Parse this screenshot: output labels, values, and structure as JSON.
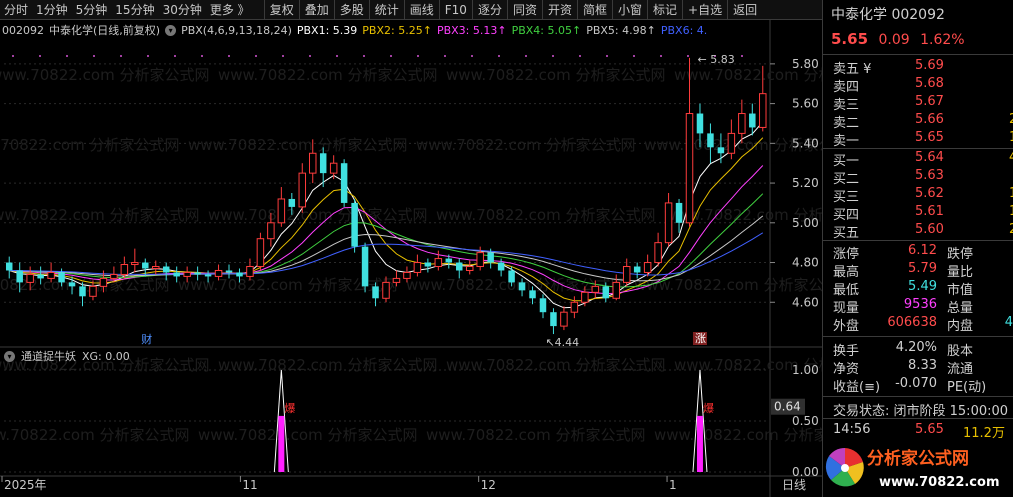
{
  "toolbar": {
    "periods": [
      "分时",
      "1分钟",
      "5分钟",
      "15分钟",
      "30分钟",
      "更多 》"
    ],
    "tools": [
      "复权",
      "叠加",
      "多股",
      "统计",
      "画线",
      "F10",
      "逐分",
      "同资",
      "开资",
      "简框",
      "小窗",
      "标记",
      "+自选",
      "返回"
    ]
  },
  "chart": {
    "code": "002092",
    "name": "中泰化学(日线,前复权)",
    "indicator": "PBX(4,6,9,13,18,24)",
    "pbx": [
      {
        "label": "PBX1: 5.39",
        "color": "#ffffff"
      },
      {
        "label": "PBX2: 5.25↑",
        "color": "#e8c000"
      },
      {
        "label": "PBX3: 5.13↑",
        "color": "#ff40ff"
      },
      {
        "label": "PBX4: 5.05↑",
        "color": "#40d040"
      },
      {
        "label": "PBX5: 4.98↑",
        "color": "#c8c8c8"
      },
      {
        "label": "PBX6: 4.",
        "color": "#4060ff"
      }
    ],
    "max_label": "5.83",
    "min_label": "4.44",
    "price_axis": [
      "5.80",
      "5.60",
      "5.40",
      "5.20",
      "5.00",
      "4.80",
      "4.60"
    ],
    "marker_cai": "财",
    "marker_zhang": "涨",
    "watermark": "www.70822.com 分析家公式网"
  },
  "indicator_panel": {
    "name": "通道捉牛妖",
    "xg": "XG: 0.00",
    "axis": [
      "1.00",
      "0.50",
      "0.00"
    ],
    "cursor_value": "0.64",
    "signal_label": "爆"
  },
  "date_axis": {
    "labels": [
      "2025年",
      "11",
      "12",
      "1"
    ],
    "right": "日线"
  },
  "chart_data": {
    "type": "candlestick",
    "title": "002092 中泰化学(日线,前复权)",
    "ylim": [
      4.4,
      5.9
    ],
    "candles": [
      [
        4.8,
        4.76,
        4.83,
        4.72
      ],
      [
        4.76,
        4.7,
        4.8,
        4.65
      ],
      [
        4.7,
        4.74,
        4.78,
        4.66
      ],
      [
        4.74,
        4.72,
        4.78,
        4.69
      ],
      [
        4.72,
        4.75,
        4.8,
        4.7
      ],
      [
        4.75,
        4.7,
        4.77,
        4.68
      ],
      [
        4.7,
        4.68,
        4.73,
        4.64
      ],
      [
        4.68,
        4.63,
        4.7,
        4.58
      ],
      [
        4.63,
        4.68,
        4.71,
        4.61
      ],
      [
        4.68,
        4.72,
        4.76,
        4.65
      ],
      [
        4.72,
        4.74,
        4.78,
        4.7
      ],
      [
        4.74,
        4.79,
        4.83,
        4.72
      ],
      [
        4.79,
        4.8,
        4.87,
        4.75
      ],
      [
        4.8,
        4.77,
        4.82,
        4.73
      ],
      [
        4.77,
        4.78,
        4.81,
        4.74
      ],
      [
        4.78,
        4.75,
        4.8,
        4.71
      ],
      [
        4.75,
        4.73,
        4.78,
        4.7
      ],
      [
        4.73,
        4.75,
        4.78,
        4.7
      ],
      [
        4.75,
        4.74,
        4.78,
        4.71
      ],
      [
        4.74,
        4.73,
        4.76,
        4.7
      ],
      [
        4.73,
        4.76,
        4.79,
        4.71
      ],
      [
        4.76,
        4.75,
        4.79,
        4.72
      ],
      [
        4.75,
        4.73,
        4.77,
        4.7
      ],
      [
        4.73,
        4.78,
        4.82,
        4.71
      ],
      [
        4.78,
        4.92,
        4.95,
        4.76
      ],
      [
        4.92,
        5.0,
        5.05,
        4.88
      ],
      [
        5.0,
        5.12,
        5.18,
        4.98
      ],
      [
        5.12,
        5.08,
        5.15,
        5.04
      ],
      [
        5.08,
        5.25,
        5.3,
        5.05
      ],
      [
        5.25,
        5.35,
        5.42,
        5.2
      ],
      [
        5.35,
        5.25,
        5.38,
        5.18
      ],
      [
        5.25,
        5.3,
        5.34,
        5.22
      ],
      [
        5.3,
        5.1,
        5.32,
        5.08
      ],
      [
        5.1,
        4.88,
        5.12,
        4.85
      ],
      [
        4.88,
        4.68,
        4.9,
        4.65
      ],
      [
        4.68,
        4.62,
        4.7,
        4.58
      ],
      [
        4.62,
        4.7,
        4.73,
        4.6
      ],
      [
        4.7,
        4.72,
        4.76,
        4.68
      ],
      [
        4.72,
        4.75,
        4.78,
        4.7
      ],
      [
        4.75,
        4.8,
        4.84,
        4.73
      ],
      [
        4.8,
        4.78,
        4.82,
        4.75
      ],
      [
        4.78,
        4.82,
        4.86,
        4.76
      ],
      [
        4.82,
        4.8,
        4.84,
        4.77
      ],
      [
        4.8,
        4.76,
        4.82,
        4.72
      ],
      [
        4.76,
        4.78,
        4.81,
        4.74
      ],
      [
        4.78,
        4.85,
        4.88,
        4.76
      ],
      [
        4.85,
        4.8,
        4.87,
        4.77
      ],
      [
        4.8,
        4.76,
        4.82,
        4.73
      ],
      [
        4.76,
        4.7,
        4.78,
        4.68
      ],
      [
        4.7,
        4.66,
        4.72,
        4.63
      ],
      [
        4.66,
        4.62,
        4.68,
        4.59
      ],
      [
        4.62,
        4.55,
        4.64,
        4.52
      ],
      [
        4.55,
        4.48,
        4.57,
        4.44
      ],
      [
        4.48,
        4.55,
        4.58,
        4.46
      ],
      [
        4.55,
        4.6,
        4.63,
        4.52
      ],
      [
        4.6,
        4.65,
        4.68,
        4.58
      ],
      [
        4.65,
        4.68,
        4.71,
        4.62
      ],
      [
        4.68,
        4.62,
        4.7,
        4.6
      ],
      [
        4.62,
        4.7,
        4.74,
        4.61
      ],
      [
        4.7,
        4.78,
        4.82,
        4.68
      ],
      [
        4.78,
        4.75,
        4.8,
        4.72
      ],
      [
        4.75,
        4.8,
        4.84,
        4.73
      ],
      [
        4.8,
        4.9,
        4.95,
        4.78
      ],
      [
        4.9,
        5.1,
        5.15,
        4.88
      ],
      [
        5.1,
        5.0,
        5.12,
        4.95
      ],
      [
        5.0,
        5.55,
        5.83,
        4.98
      ],
      [
        5.55,
        5.45,
        5.6,
        5.38
      ],
      [
        5.45,
        5.38,
        5.5,
        5.3
      ],
      [
        5.38,
        5.35,
        5.45,
        5.3
      ],
      [
        5.35,
        5.45,
        5.52,
        5.32
      ],
      [
        5.45,
        5.55,
        5.62,
        5.4
      ],
      [
        5.55,
        5.48,
        5.6,
        5.44
      ],
      [
        5.48,
        5.65,
        5.79,
        5.46
      ]
    ],
    "indicator": {
      "name": "通道捉牛妖",
      "signals_at_index": [
        26,
        66
      ],
      "ylim": [
        0,
        1
      ]
    }
  },
  "panel": {
    "title": "中泰化学 002092",
    "price": "5.65",
    "change": "0.09",
    "pct": "1.62%",
    "asks": [
      {
        "l": "卖五 ¥",
        "p": "5.69"
      },
      {
        "l": "卖四",
        "p": "5.68"
      },
      {
        "l": "卖三",
        "p": "5.67"
      },
      {
        "l": "卖二",
        "p": "5.66",
        "v": "2"
      },
      {
        "l": "卖一",
        "p": "5.65",
        "v": "1"
      }
    ],
    "bids": [
      {
        "l": "买一",
        "p": "5.64",
        "v": "4"
      },
      {
        "l": "买二",
        "p": "5.63"
      },
      {
        "l": "买三",
        "p": "5.62",
        "v": "1"
      },
      {
        "l": "买四",
        "p": "5.61",
        "v": "1"
      },
      {
        "l": "买五",
        "p": "5.60",
        "v": "2"
      }
    ],
    "stats": [
      {
        "a": "涨停",
        "b": "6.12",
        "bc": "#ff4c4c",
        "c": "跌停"
      },
      {
        "a": "最高",
        "b": "5.79",
        "bc": "#ff4c4c",
        "c": "量比"
      },
      {
        "a": "最低",
        "b": "5.49",
        "bc": "#40e0e0",
        "c": "市值"
      },
      {
        "a": "现量",
        "b": "9536",
        "bc": "#ff40ff",
        "c": "总量"
      },
      {
        "a": "外盘",
        "b": "606638",
        "bc": "#ff4c4c",
        "c": "内盘",
        "d": "4",
        "dc": "#40e0e0"
      }
    ],
    "stats2": [
      {
        "a": "换手",
        "b": "4.20%",
        "bc": "#d0d0d0",
        "c": "股本"
      },
      {
        "a": "净资",
        "b": "8.33",
        "bc": "#d0d0d0",
        "c": "流通"
      },
      {
        "a": "收益(≡)",
        "b": "-0.070",
        "bc": "#d0d0d0",
        "c": "PE(动)"
      }
    ],
    "state_label": "交易状态: 闭市阶段 15:00:00",
    "tick_time": "14:56",
    "tick_price": "5.65",
    "tick_vol": "11.2万"
  },
  "logo": {
    "text": "分析家公式网",
    "url_text": "www.70822.com"
  }
}
